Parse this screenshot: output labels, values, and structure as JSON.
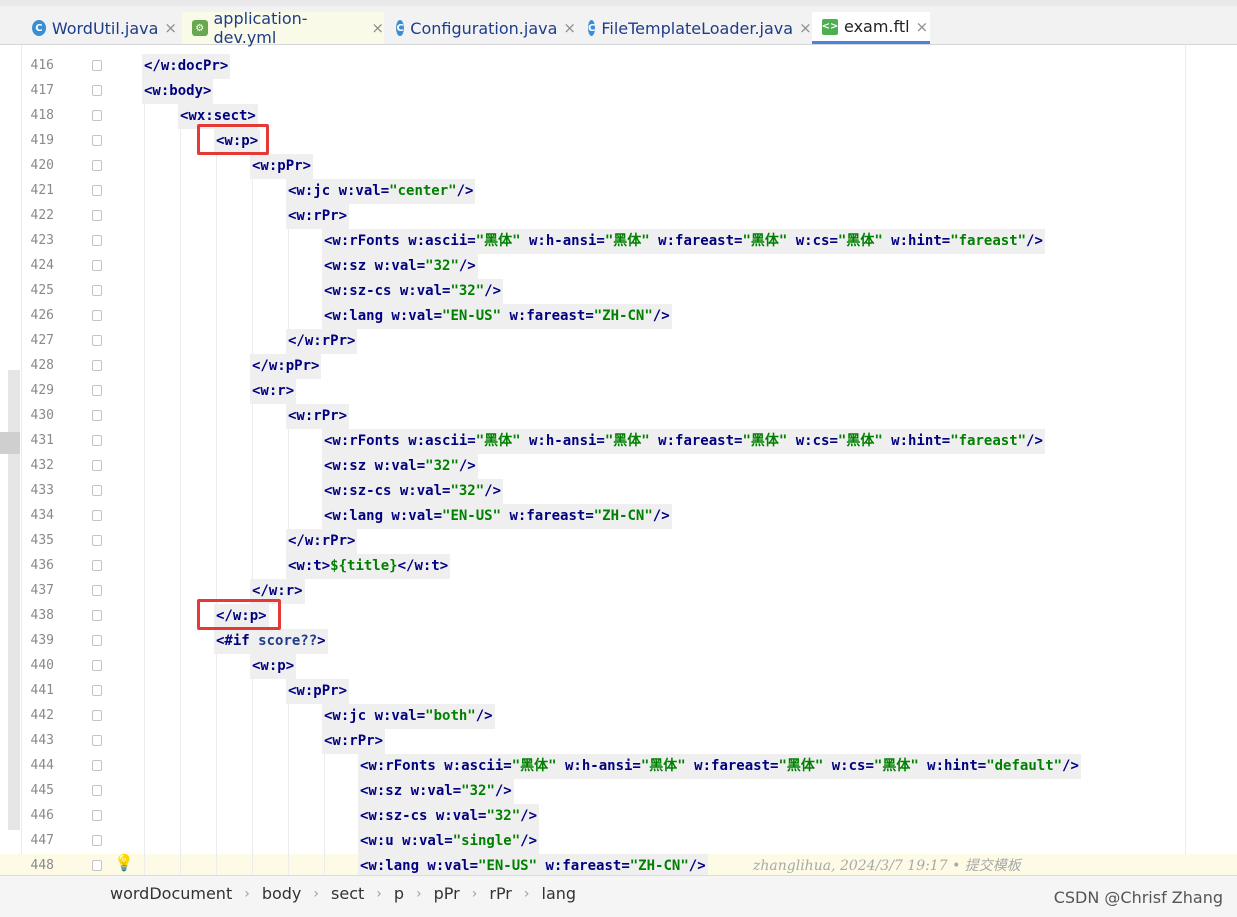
{
  "tabs": [
    {
      "label": "WordUtil.java",
      "icon": "java-class-icon"
    },
    {
      "label": "application-dev.yml",
      "icon": "yml-config-icon"
    },
    {
      "label": "Configuration.java",
      "icon": "java-class-icon"
    },
    {
      "label": "FileTemplateLoader.java",
      "icon": "java-class-icon"
    },
    {
      "label": "exam.ftl",
      "icon": "ftl-template-icon",
      "active": true
    }
  ],
  "lines": [
    {
      "n": "416",
      "indent": 0,
      "text": "</w:docPr>"
    },
    {
      "n": "417",
      "indent": 0,
      "text": "<w:body>"
    },
    {
      "n": "418",
      "indent": 1,
      "text": "<wx:sect>"
    },
    {
      "n": "419",
      "indent": 2,
      "text": "<w:p>"
    },
    {
      "n": "420",
      "indent": 3,
      "text": "<w:pPr>"
    },
    {
      "n": "421",
      "indent": 4,
      "text": "<w:jc w:val=\"center\"/>"
    },
    {
      "n": "422",
      "indent": 4,
      "text": "<w:rPr>"
    },
    {
      "n": "423",
      "indent": 5,
      "text": "<w:rFonts w:ascii=\"黑体\" w:h-ansi=\"黑体\" w:fareast=\"黑体\" w:cs=\"黑体\" w:hint=\"fareast\"/>"
    },
    {
      "n": "424",
      "indent": 5,
      "text": "<w:sz w:val=\"32\"/>"
    },
    {
      "n": "425",
      "indent": 5,
      "text": "<w:sz-cs w:val=\"32\"/>"
    },
    {
      "n": "426",
      "indent": 5,
      "text": "<w:lang w:val=\"EN-US\" w:fareast=\"ZH-CN\"/>"
    },
    {
      "n": "427",
      "indent": 4,
      "text": "</w:rPr>"
    },
    {
      "n": "428",
      "indent": 3,
      "text": "</w:pPr>"
    },
    {
      "n": "429",
      "indent": 3,
      "text": "<w:r>"
    },
    {
      "n": "430",
      "indent": 4,
      "text": "<w:rPr>"
    },
    {
      "n": "431",
      "indent": 5,
      "text": "<w:rFonts w:ascii=\"黑体\" w:h-ansi=\"黑体\" w:fareast=\"黑体\" w:cs=\"黑体\" w:hint=\"fareast\"/>"
    },
    {
      "n": "432",
      "indent": 5,
      "text": "<w:sz w:val=\"32\"/>"
    },
    {
      "n": "433",
      "indent": 5,
      "text": "<w:sz-cs w:val=\"32\"/>"
    },
    {
      "n": "434",
      "indent": 5,
      "text": "<w:lang w:val=\"EN-US\" w:fareast=\"ZH-CN\"/>"
    },
    {
      "n": "435",
      "indent": 4,
      "text": "</w:rPr>"
    },
    {
      "n": "436",
      "indent": 4,
      "text": "<w:t>${title}</w:t>"
    },
    {
      "n": "437",
      "indent": 3,
      "text": "</w:r>"
    },
    {
      "n": "438",
      "indent": 2,
      "text": "</w:p>"
    },
    {
      "n": "439",
      "indent": 2,
      "text": "<#if score??>"
    },
    {
      "n": "440",
      "indent": 3,
      "text": "<w:p>"
    },
    {
      "n": "441",
      "indent": 4,
      "text": "<w:pPr>"
    },
    {
      "n": "442",
      "indent": 5,
      "text": "<w:jc w:val=\"both\"/>"
    },
    {
      "n": "443",
      "indent": 5,
      "text": "<w:rPr>"
    },
    {
      "n": "444",
      "indent": 6,
      "text": "<w:rFonts w:ascii=\"黑体\" w:h-ansi=\"黑体\" w:fareast=\"黑体\" w:cs=\"黑体\" w:hint=\"default\"/>"
    },
    {
      "n": "445",
      "indent": 6,
      "text": "<w:sz w:val=\"32\"/>"
    },
    {
      "n": "446",
      "indent": 6,
      "text": "<w:sz-cs w:val=\"32\"/>"
    },
    {
      "n": "447",
      "indent": 6,
      "text": "<w:u w:val=\"single\"/>"
    },
    {
      "n": "448",
      "indent": 6,
      "text": "<w:lang w:val=\"EN-US\" w:fareast=\"ZH-CN\"/>",
      "current": true
    }
  ],
  "blame": "zhanglihua, 2024/3/7 19:17 • 提交模板",
  "breadcrumbs": [
    "wordDocument",
    "body",
    "sect",
    "p",
    "pPr",
    "rPr",
    "lang"
  ],
  "watermark": "CSDN @Chrisf Zhang",
  "colors": {
    "tag": "#000080",
    "string": "#008000",
    "highlight_box": "#e53935",
    "tab_underline": "#4a83e0"
  }
}
